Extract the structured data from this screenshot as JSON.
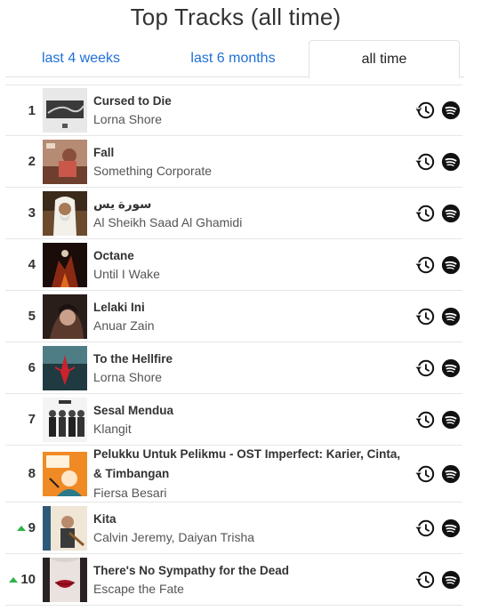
{
  "page": {
    "title": "Top Tracks (all time)"
  },
  "tabs": [
    {
      "label": "last 4 weeks",
      "active": false
    },
    {
      "label": "last 6 months",
      "active": false
    },
    {
      "label": "all time",
      "active": true
    }
  ],
  "colors": {
    "link": "#1f6fd6",
    "rank_up": "#2eb34a",
    "icon": "#111111"
  },
  "icons": {
    "history": "history-icon",
    "spotify": "spotify-icon",
    "rank_change": "rank-up-arrow-icon"
  },
  "tracks": [
    {
      "rank": "1",
      "title": "Cursed to Die",
      "artist": "Lorna Shore",
      "rank_change": "none"
    },
    {
      "rank": "2",
      "title": "Fall",
      "artist": "Something Corporate",
      "rank_change": "none"
    },
    {
      "rank": "3",
      "title": "سورة يس",
      "artist": "Al Sheikh Saad Al Ghamidi",
      "rank_change": "none"
    },
    {
      "rank": "4",
      "title": "Octane",
      "artist": "Until I Wake",
      "rank_change": "none"
    },
    {
      "rank": "5",
      "title": "Lelaki Ini",
      "artist": "Anuar Zain",
      "rank_change": "none"
    },
    {
      "rank": "6",
      "title": "To the Hellfire",
      "artist": "Lorna Shore",
      "rank_change": "none"
    },
    {
      "rank": "7",
      "title": "Sesal Mendua",
      "artist": "Klangit",
      "rank_change": "none"
    },
    {
      "rank": "8",
      "title": "Pelukku Untuk Pelikmu - OST Imperfect: Karier, Cinta, & Timbangan",
      "artist": "Fiersa Besari",
      "rank_change": "none"
    },
    {
      "rank": "9",
      "title": "Kita",
      "artist": "Calvin Jeremy, Daiyan Trisha",
      "rank_change": "up"
    },
    {
      "rank": "10",
      "title": "There's No Sympathy for the Dead",
      "artist": "Escape the Fate",
      "rank_change": "up"
    }
  ]
}
